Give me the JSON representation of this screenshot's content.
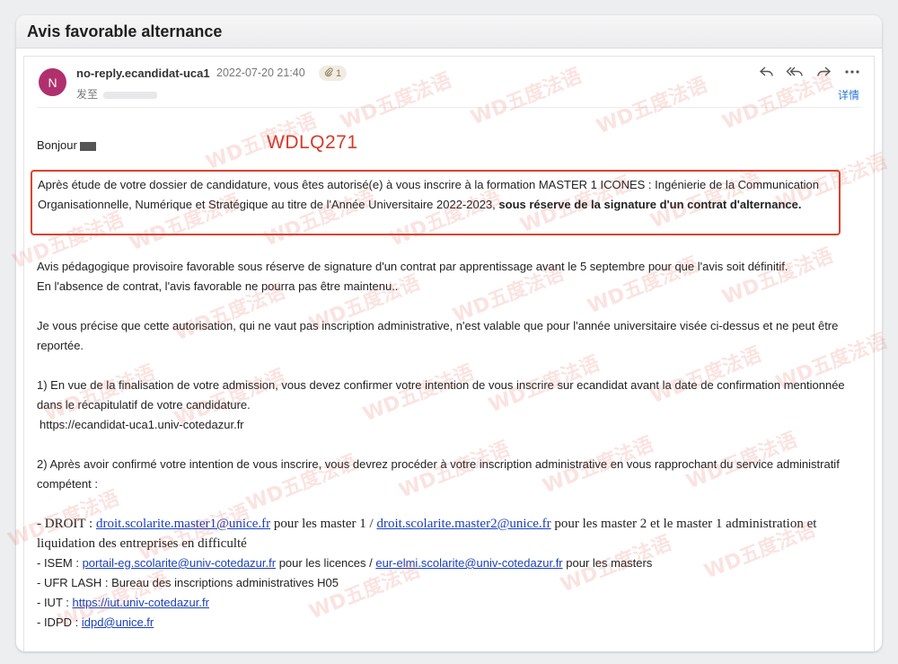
{
  "window": {
    "title": "Avis favorable alternance"
  },
  "email": {
    "avatar_letter": "N",
    "sender": "no-reply.ecandidat-uca1",
    "date": "2022-07-20 21:40",
    "attachment_count": "1",
    "sent_to_label": "发至",
    "details_label": "详情"
  },
  "body": {
    "greeting": "Bonjour",
    "stamp": "WDLQ271",
    "box_text": "Après étude de votre dossier de candidature, vous êtes autorisé(e) à vous inscrire à la formation MASTER 1 ICONES : Ingénierie de la Communication Organisationnelle, Numérique et Stratégique au titre de l'Année Universitaire 2022-2023,",
    "box_bold": "sous réserve de la signature d'un contrat d'alternance.",
    "p1_line1": "Avis pédagogique provisoire favorable sous réserve de signature d'un contrat par apprentissage avant le 5 septembre pour que l'avis soit définitif.",
    "p1_line2": "En l'absence de contrat, l'avis favorable ne pourra pas être maintenu..",
    "p2": "Je vous précise que cette autorisation, qui ne vaut pas inscription administrative, n'est valable que pour l'année universitaire visée ci-dessus et ne peut être reportée.",
    "p3": "1) En vue de la finalisation de votre admission, vous devez confirmer votre intention de vous inscrire sur ecandidat avant la date de confirmation mentionnée dans le récapitulatif de votre candidature.",
    "p3_url": "https://ecandidat-uca1.univ-cotedazur.fr",
    "p4": "2) Après avoir confirmé votre intention de vous inscrire, vous devrez procéder à votre inscription administrative en vous rapprochant du service administratif compétent :",
    "droit_prefix": "- DROIT : ",
    "droit_email1": "droit.scolarite.master1@unice.fr",
    "droit_mid": " pour les master 1 / ",
    "droit_email2": "droit.scolarite.master2@unice.fr",
    "droit_suffix": " pour les master 2 et le master 1 administration et liquidation des entreprises en difficulté",
    "isem_prefix": "- ISEM : ",
    "isem_email1": "portail-eg.scolarite@univ-cotedazur.fr",
    "isem_mid": " pour les licences  / ",
    "isem_email2": "eur-elmi.scolarite@univ-cotedazur.fr",
    "isem_suffix": " pour les masters",
    "lash": "- UFR LASH : Bureau des inscriptions administratives H05",
    "iut_prefix": "- IUT : ",
    "iut_url": "https://iut.univ-cotedazur.fr ",
    "idpd_prefix": "- IDPD : ",
    "idpd_email": "idpd@unice.fr"
  },
  "watermark": {
    "text": "WD五度法语"
  },
  "colors": {
    "accent_link": "#1a3fb8",
    "stamp_red": "#d63a2a",
    "box_border": "#d8432e",
    "avatar": "#b0306d"
  }
}
